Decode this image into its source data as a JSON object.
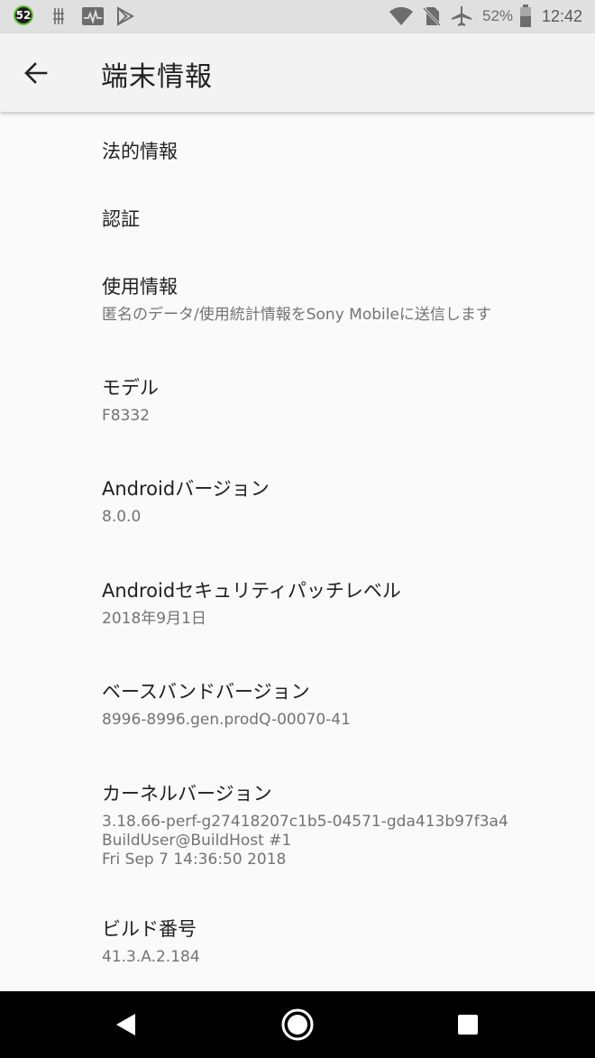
{
  "status_bar": {
    "notification_count": "52",
    "battery_percent": "52%",
    "time": "12:42",
    "icons": [
      "usb-debug-icon",
      "activity-monitor-icon",
      "play-store-icon",
      "wifi-icon",
      "no-sim-icon",
      "airplane-mode-icon",
      "battery-icon"
    ]
  },
  "app_bar": {
    "title": "端末情報",
    "back_icon": "arrow-back-icon"
  },
  "items": [
    {
      "title": "法的情報"
    },
    {
      "title": "認証"
    },
    {
      "title": "使用情報",
      "summary": "匿名のデータ/使用統計情報をSony Mobileに送信します"
    },
    {
      "title": "モデル",
      "summary": "F8332"
    },
    {
      "title": "Androidバージョン",
      "summary": "8.0.0"
    },
    {
      "title": "Androidセキュリティパッチレベル",
      "summary": "2018年9月1日"
    },
    {
      "title": "ベースバンドバージョン",
      "summary": "8996-8996.gen.prodQ-00070-41"
    },
    {
      "title": "カーネルバージョン",
      "summary": "3.18.66-perf-g27418207c1b5-04571-gda413b97f3a4\nBuildUser@BuildHost #1\nFri Sep 7 14:36:50 2018"
    },
    {
      "title": "ビルド番号",
      "summary": "41.3.A.2.184"
    }
  ],
  "nav_bar": {
    "back": "nav-back-icon",
    "home": "nav-home-icon",
    "recents": "nav-recents-icon"
  },
  "colors": {
    "status_bar_bg": "#e0e0e0",
    "app_bar_bg": "#f3f3f3",
    "page_bg": "#fafafa",
    "nav_bar_bg": "#000000",
    "badge_ring": "#5ec236"
  }
}
